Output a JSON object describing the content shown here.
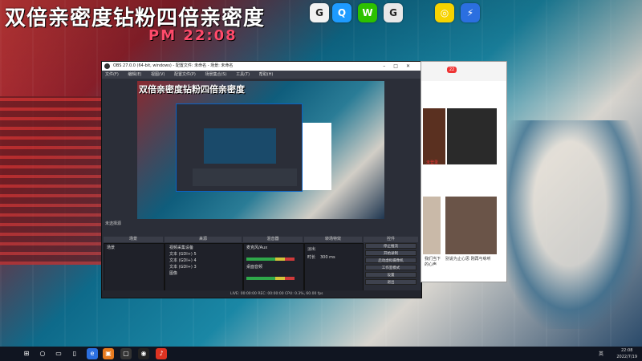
{
  "desktop": {
    "banner": "双倍亲密度钻粉四倍亲密度",
    "clock_overlay": "PM 22:08"
  },
  "desktop_icons": [
    {
      "name": "app-icon-1",
      "color": "#f2f2f2",
      "glyph": "G"
    },
    {
      "name": "qq-icon",
      "color": "#1e9bff",
      "glyph": "Q"
    },
    {
      "name": "wechat-icon",
      "color": "#2dc100",
      "glyph": "W"
    },
    {
      "name": "app-icon-2",
      "color": "#e8e8e8",
      "glyph": "G"
    },
    {
      "name": "app-icon-3",
      "color": "#f7d300",
      "glyph": "◎"
    },
    {
      "name": "app-icon-4",
      "color": "#2b6fe0",
      "glyph": "⚡"
    }
  ],
  "obs": {
    "title": "OBS 27.0.0 (64-bit, windows) - 配置文件: 未命名 - 场景: 未命名",
    "menu": [
      "文件(F)",
      "编辑(E)",
      "视图(V)",
      "配置文件(P)",
      "场景集合(S)",
      "工具(T)",
      "帮助(H)"
    ],
    "preview_title": "双倍亲密度钻粉四倍亲密度",
    "scene_label": "未选择源",
    "docks": {
      "scenes": {
        "header": "场景",
        "items": [
          "场景"
        ]
      },
      "sources": {
        "header": "来源",
        "items": [
          "视频采集设备",
          "文本 (GDI+) 5",
          "文本 (GDI+) 4",
          "文本 (GDI+) 3",
          "图像"
        ]
      },
      "mixer": {
        "header": "混音器",
        "tracks": [
          "麦克风/Aux",
          "桌面音频"
        ]
      },
      "transitions": {
        "header": "转场特效",
        "type": "淡出",
        "duration_label": "时长",
        "duration": "300 ms"
      },
      "controls": {
        "header": "控件",
        "buttons": [
          "停止推流",
          "开始录制",
          "启动虚拟摄像机",
          "工作室模式",
          "设置",
          "退出"
        ]
      }
    },
    "status": "LIVE: 00:00:00   REC: 00:00:00   CPU: 0.3%, 60.00 fps"
  },
  "panel": {
    "badge": "22",
    "tag": "未登录",
    "captions": [
      "我们当下的心声",
      "别说为止心思 刚再与咏听"
    ]
  },
  "taskbar": {
    "lang": "英",
    "time": "22:08",
    "date": "2022/7/19"
  }
}
